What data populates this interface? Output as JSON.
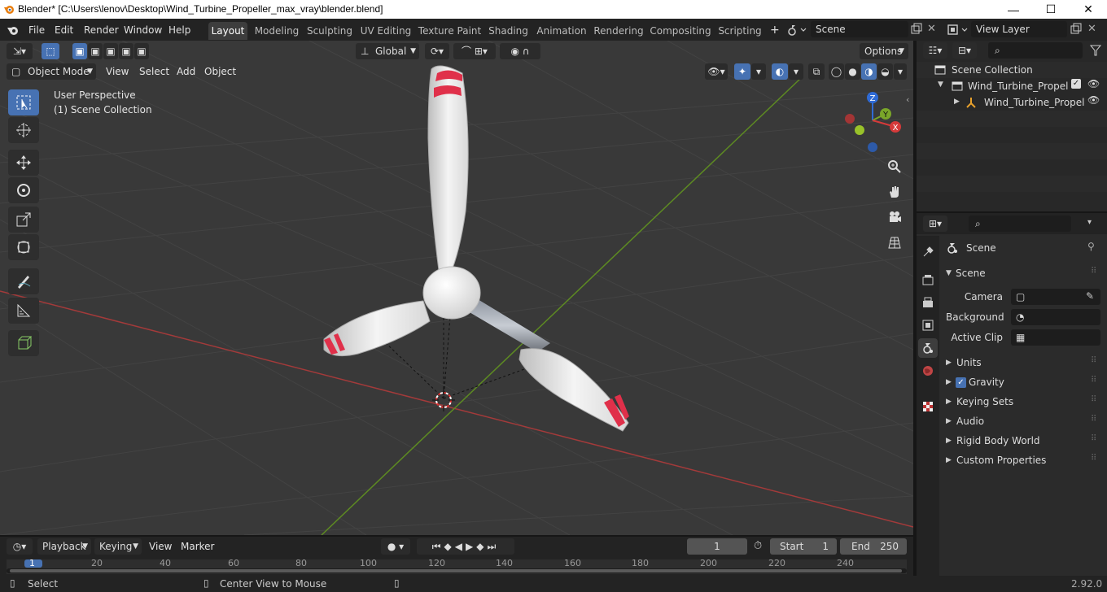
{
  "window": {
    "title": "Blender* [C:\\Users\\lenov\\Desktop\\Wind_Turbine_Propeller_max_vray\\blender.blend]",
    "controls": {
      "minimize": "—",
      "maximize": "☐",
      "close": "✕"
    }
  },
  "menu": {
    "file": "File",
    "edit": "Edit",
    "render": "Render",
    "window": "Window",
    "help": "Help"
  },
  "workspaces": [
    "Layout",
    "Modeling",
    "Sculpting",
    "UV Editing",
    "Texture Paint",
    "Shading",
    "Animation",
    "Rendering",
    "Compositing",
    "Scripting"
  ],
  "add_workspace": "+",
  "scene_field": "Scene",
  "view_layer_field": "View Layer",
  "viewport": {
    "transform_orientation": "Global",
    "options": "Options",
    "mode": "Object Mode",
    "menus": [
      "View",
      "Select",
      "Add",
      "Object"
    ],
    "overlay_line1": "User Perspective",
    "overlay_line2": "(1) Scene Collection",
    "gizmo_axes": {
      "z": "Z",
      "y": "Y",
      "x": "X"
    }
  },
  "outliner": {
    "root": "Scene Collection",
    "collection": "Wind_Turbine_Propeller_(",
    "object": "Wind_Turbine_Propel"
  },
  "properties": {
    "header": "Scene",
    "panel": "Scene",
    "camera_label": "Camera",
    "background_label": "Background ...",
    "active_clip_label": "Active Clip",
    "sections": [
      "Units",
      "Gravity",
      "Keying Sets",
      "Audio",
      "Rigid Body World",
      "Custom Properties"
    ]
  },
  "timeline": {
    "menus": [
      "Playback",
      "Keying",
      "View",
      "Marker"
    ],
    "current_frame": "1",
    "start_label": "Start",
    "start_value": "1",
    "end_label": "End",
    "end_value": "250",
    "ticks": [
      "1",
      "20",
      "40",
      "60",
      "80",
      "100",
      "120",
      "140",
      "160",
      "180",
      "200",
      "220",
      "240"
    ]
  },
  "status": {
    "select": "Select",
    "center": "Center View to Mouse",
    "version": "2.92.0"
  },
  "colors": {
    "accent": "#4772b3",
    "axis_x": "#c43a3a",
    "axis_y": "#6a9a2a",
    "blade_stripe": "#e0304a"
  }
}
